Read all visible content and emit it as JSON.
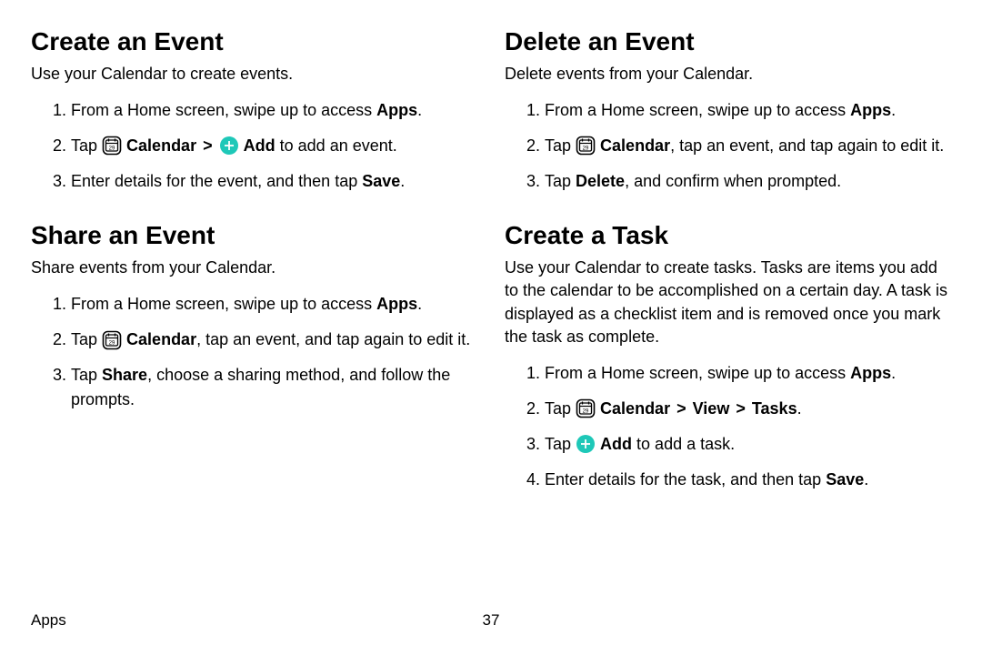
{
  "footer": {
    "label": "Apps",
    "page": "37"
  },
  "chevron": ">",
  "leftCol": {
    "sect1": {
      "heading": "Create an Event",
      "intro": "Use your Calendar to create events.",
      "steps": {
        "s1": {
          "prefix": "From a Home screen, swipe up to access ",
          "bold": "Apps",
          "suffix": "."
        },
        "s2": {
          "p1": "Tap ",
          "calLabel": "Calendar",
          "addLabel": "Add",
          "suffix": " to add an event."
        },
        "s3": {
          "p1": "Enter details for the event, and then tap ",
          "bold": "Save",
          "suffix": "."
        }
      }
    },
    "sect2": {
      "heading": "Share an Event",
      "intro": "Share events from your Calendar.",
      "steps": {
        "s1": {
          "prefix": "From a Home screen, swipe up to access ",
          "bold": "Apps",
          "suffix": "."
        },
        "s2": {
          "p1": "Tap ",
          "calLabel": "Calendar",
          "suffix": ", tap an event, and tap again to edit it."
        },
        "s3": {
          "p1": "Tap ",
          "bold": "Share",
          "suffix": ", choose a sharing method, and follow the prompts."
        }
      }
    }
  },
  "rightCol": {
    "sect1": {
      "heading": "Delete an Event",
      "intro": "Delete events from your Calendar.",
      "steps": {
        "s1": {
          "prefix": "From a Home screen, swipe up to access ",
          "bold": "Apps",
          "suffix": "."
        },
        "s2": {
          "p1": "Tap ",
          "calLabel": "Calendar",
          "suffix": ", tap an event, and tap again to edit it."
        },
        "s3": {
          "p1": "Tap ",
          "bold": "Delete",
          "suffix": ", and confirm when prompted."
        }
      }
    },
    "sect2": {
      "heading": "Create a Task",
      "intro": "Use your Calendar to create tasks. Tasks are items you add to the calendar to be accomplished on a certain day. A task is displayed as a checklist item and is removed once you mark the task as complete.",
      "steps": {
        "s1": {
          "prefix": "From a Home screen, swipe up to access ",
          "bold": "Apps",
          "suffix": "."
        },
        "s2": {
          "p1": "Tap ",
          "calLabel": "Calendar",
          "viewLabel": "View",
          "tasksLabel": "Tasks",
          "suffix": "."
        },
        "s3": {
          "p1": "Tap ",
          "addLabel": "Add",
          "suffix": " to add a task."
        },
        "s4": {
          "p1": "Enter details for the task, and then tap ",
          "bold": "Save",
          "suffix": "."
        }
      }
    }
  }
}
